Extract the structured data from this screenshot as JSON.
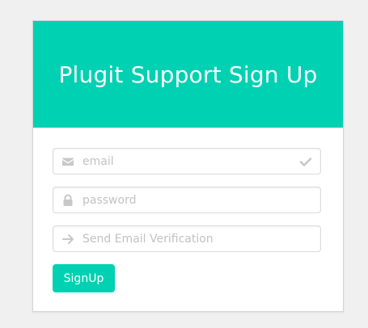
{
  "header": {
    "title": "Plugit Support Sign Up"
  },
  "form": {
    "email": {
      "placeholder": "email",
      "value": "",
      "icon_left": "envelope-icon",
      "icon_right": "check-icon"
    },
    "password": {
      "placeholder": "password",
      "value": "",
      "icon_left": "lock-icon"
    },
    "verification": {
      "placeholder": "Send Email Verification",
      "value": "",
      "icon_left": "arrow-right-icon"
    },
    "submit_label": "SignUp"
  },
  "colors": {
    "accent": "#00d1b2",
    "page_background": "#f0f0f0",
    "icon_gray": "#c8c8c8"
  }
}
